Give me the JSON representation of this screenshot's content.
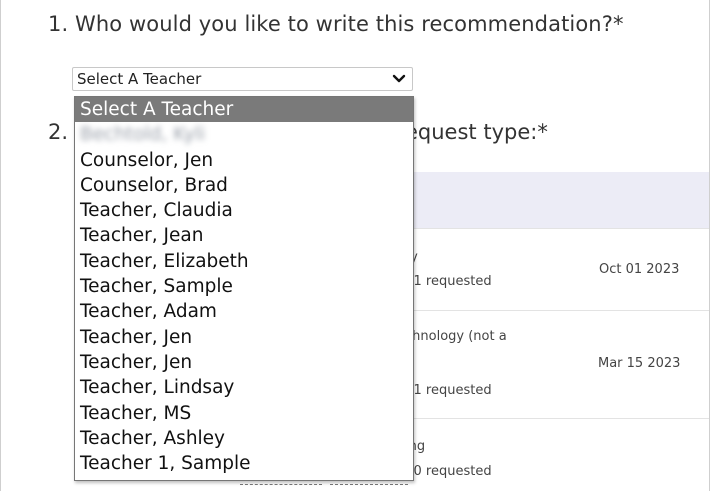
{
  "questions": {
    "q1": "1. Who would you like to write this recommendation?*",
    "q2_prefix": "2.",
    "q2_tail": "equest type:*"
  },
  "select": {
    "value": "Select A Teacher"
  },
  "dropdown": {
    "options": [
      "Select A Teacher",
      "Bechtold, Kyli",
      "Counselor, Jen",
      "Counselor, Brad",
      "Teacher, Claudia",
      "Teacher, Jean",
      "Teacher, Elizabeth",
      "Teacher, Sample",
      "Teacher, Adam",
      "Teacher, Jen",
      "Teacher, Jen",
      "Teacher, Lindsay",
      "Teacher, MS",
      "Teacher, Ashley",
      "Teacher 1, Sample"
    ]
  },
  "table": {
    "rows": [
      {
        "line1": "ty",
        "line2": "/ 1 requested",
        "date": "Oct 01 2023"
      },
      {
        "line1": "chnology (not a",
        "line2": "/ 1 requested",
        "date": "Mar 15 2023"
      },
      {
        "line1": "ing",
        "line2": "/ 0 requested",
        "date": ""
      }
    ]
  },
  "icons": {
    "chevron": "chevron-down-icon"
  }
}
